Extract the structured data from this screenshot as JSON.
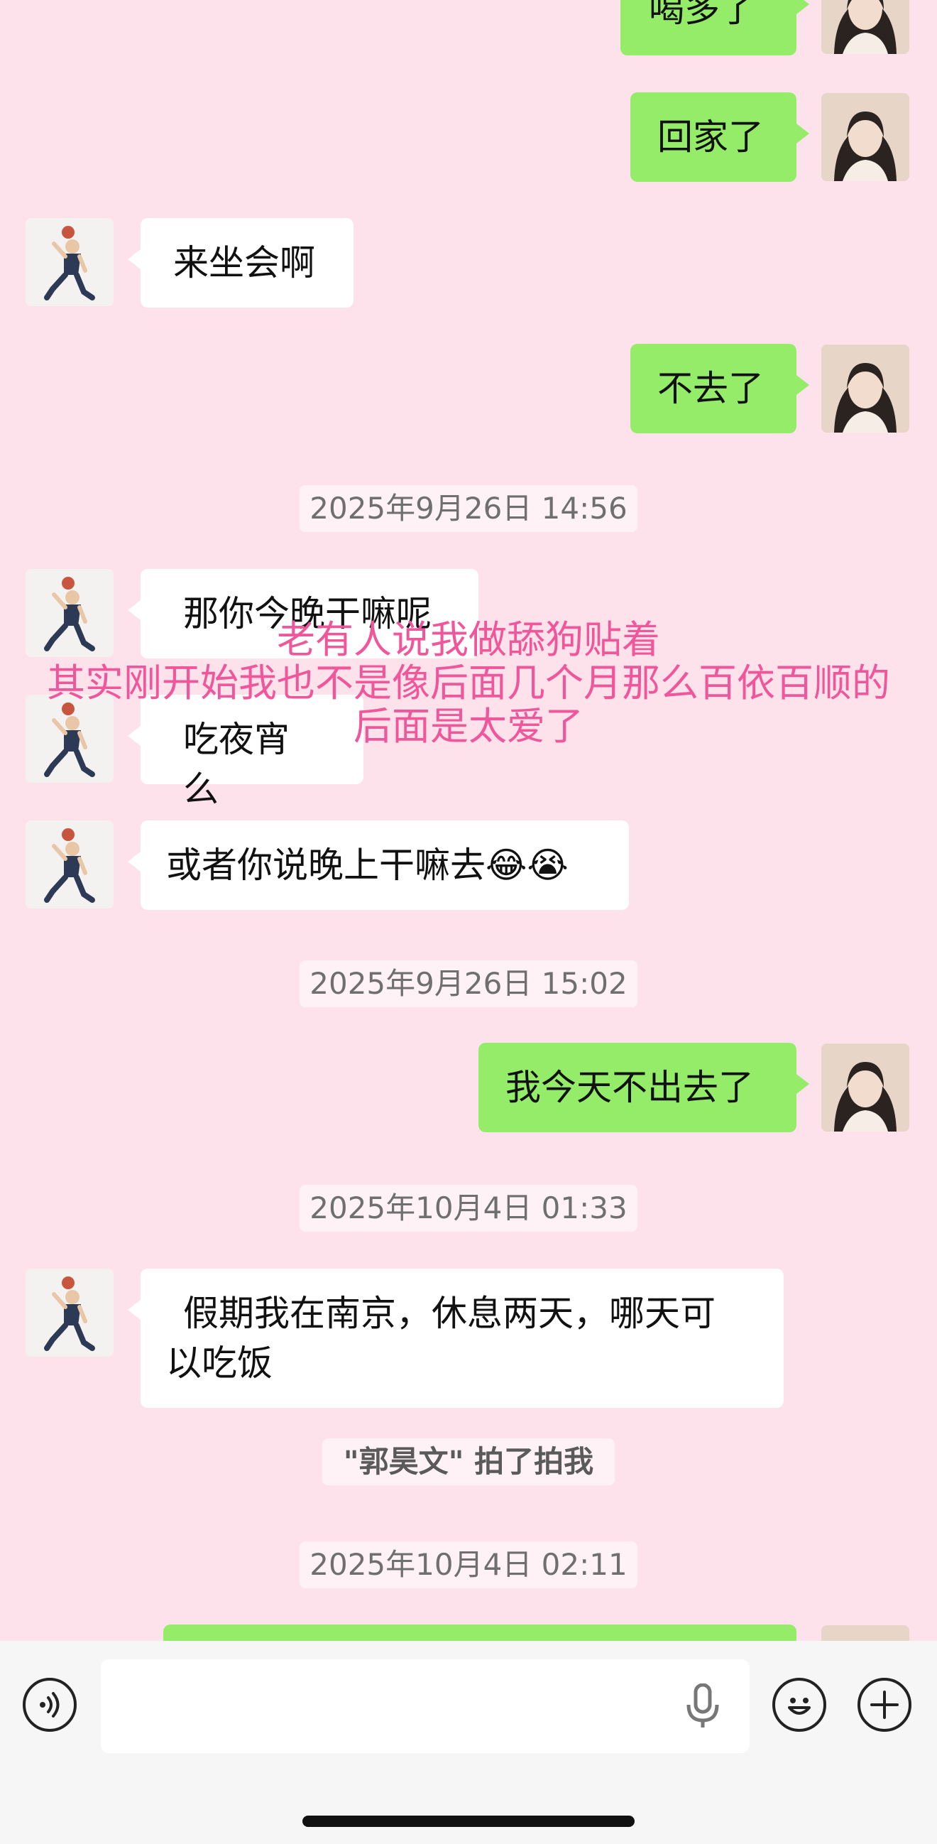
{
  "messages": {
    "m0": "喝多了",
    "m1": "回家了",
    "m2": "来坐会啊",
    "m3": "不去了",
    "m4": "那你今晚干嘛呢",
    "m5": "吃夜宵么",
    "m6": "或者你说晚上干嘛去😂😭",
    "m7": "我今天不出去了",
    "m8_line1": "假期我在南京，休息两天，哪天可",
    "m8_line2": "以吃饭"
  },
  "timestamps": {
    "t1": "2025年9月26日 14:56",
    "t2": "2025年9月26日 15:02",
    "t3": "2025年10月4日 01:33",
    "t4": "2025年10月4日 02:11"
  },
  "system": {
    "pat": "\"郭昊文\" 拍了拍我"
  },
  "overlay": {
    "line1": "老有人说我做舔狗贴着",
    "line2": "其实刚开始我也不是像后面几个月那么百依百顺的",
    "line3": "后面是太爱了"
  },
  "input": {
    "value": ""
  },
  "colors": {
    "background": "#fde2ec",
    "my_bubble": "#95ec69",
    "peer_bubble": "#ffffff",
    "overlay_text": "#f0569a"
  },
  "icons": [
    "voice-toggle-icon",
    "microphone-icon",
    "emoji-icon",
    "plus-icon"
  ]
}
